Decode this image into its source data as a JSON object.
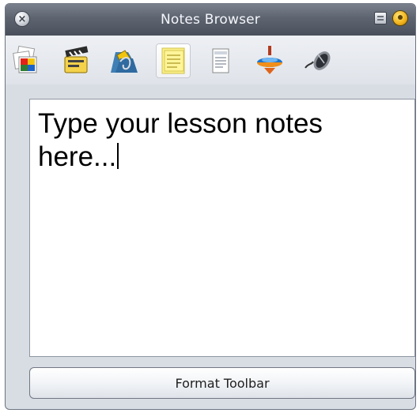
{
  "window": {
    "title": "Notes Browser"
  },
  "titlebar": {
    "close_glyph": "×",
    "close_icon": "close-icon",
    "pin_icon": "pin-icon",
    "help_icon": "help-icon"
  },
  "toolbar": {
    "tools": [
      {
        "icon": "gallery-icon"
      },
      {
        "icon": "clapperboard-icon"
      },
      {
        "icon": "attachments-icon"
      },
      {
        "icon": "sticky-notes-icon",
        "selected": true
      },
      {
        "icon": "page-icon"
      },
      {
        "icon": "spinning-top-icon"
      },
      {
        "icon": "mouse-icon"
      }
    ]
  },
  "notes": {
    "text": "Type your lesson notes here..."
  },
  "footer": {
    "format_toolbar_label": "Format Toolbar"
  }
}
